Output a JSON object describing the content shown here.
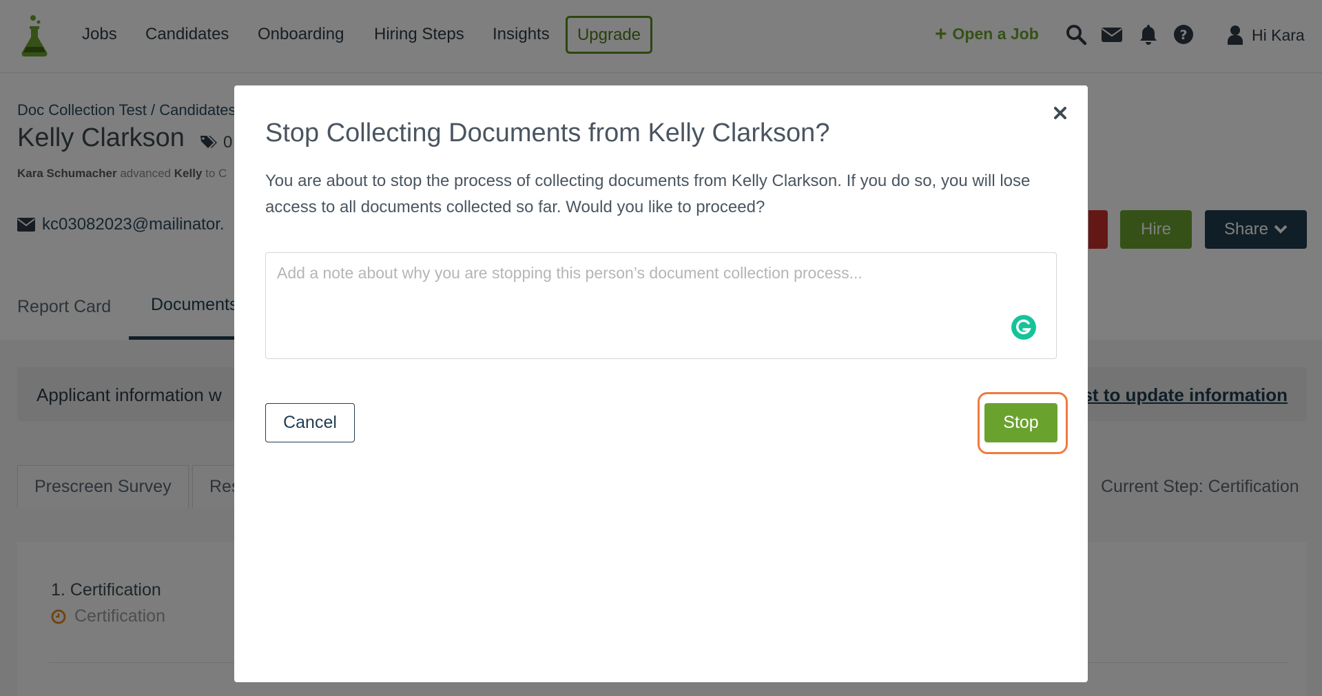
{
  "nav": {
    "items": [
      "Jobs",
      "Candidates",
      "Onboarding",
      "Hiring Steps",
      "Insights"
    ],
    "upgrade": "Upgrade",
    "open_job": "Open a Job",
    "greeting": "Hi Kara"
  },
  "candidate": {
    "breadcrumb": "Doc Collection Test / Candidates",
    "name": "Kelly Clarkson",
    "tag_count": "0",
    "advanced_by": "Kara Schumacher",
    "advanced_text": "advanced",
    "advanced_who": "Kelly",
    "advanced_to": "to C",
    "email": "kc03082023@mailinator."
  },
  "actions": {
    "hire": "Hire",
    "share": "Share"
  },
  "tabs": [
    "Report Card",
    "Documents"
  ],
  "alert": {
    "text": "Applicant information w",
    "link": "st to update information"
  },
  "sub_tabs": [
    "Prescreen Survey",
    "Res"
  ],
  "current_step": "Current Step: Certification",
  "step": {
    "title": "1. Certification",
    "sub": "Certification"
  },
  "modal": {
    "title": "Stop Collecting Documents from Kelly Clarkson?",
    "body": "You are about to stop the process of collecting documents from Kelly Clarkson. If you do so, you will lose access to all documents collected so far. Would you like to proceed?",
    "note_placeholder": "Add a note about why you are stopping this person’s document collection process...",
    "note_value": "",
    "cancel": "Cancel",
    "stop": "Stop"
  },
  "colors": {
    "brand_green": "#6aa22e",
    "navy": "#1f3c4f",
    "danger": "#c9302c",
    "highlight": "#f07a3c"
  },
  "icons": [
    "flask-logo",
    "plus-icon",
    "search-icon",
    "envelope-icon",
    "bell-icon",
    "help-icon",
    "user-icon",
    "tag-icon",
    "chevron-down-icon",
    "clock-icon",
    "close-icon",
    "grammarly-icon"
  ]
}
